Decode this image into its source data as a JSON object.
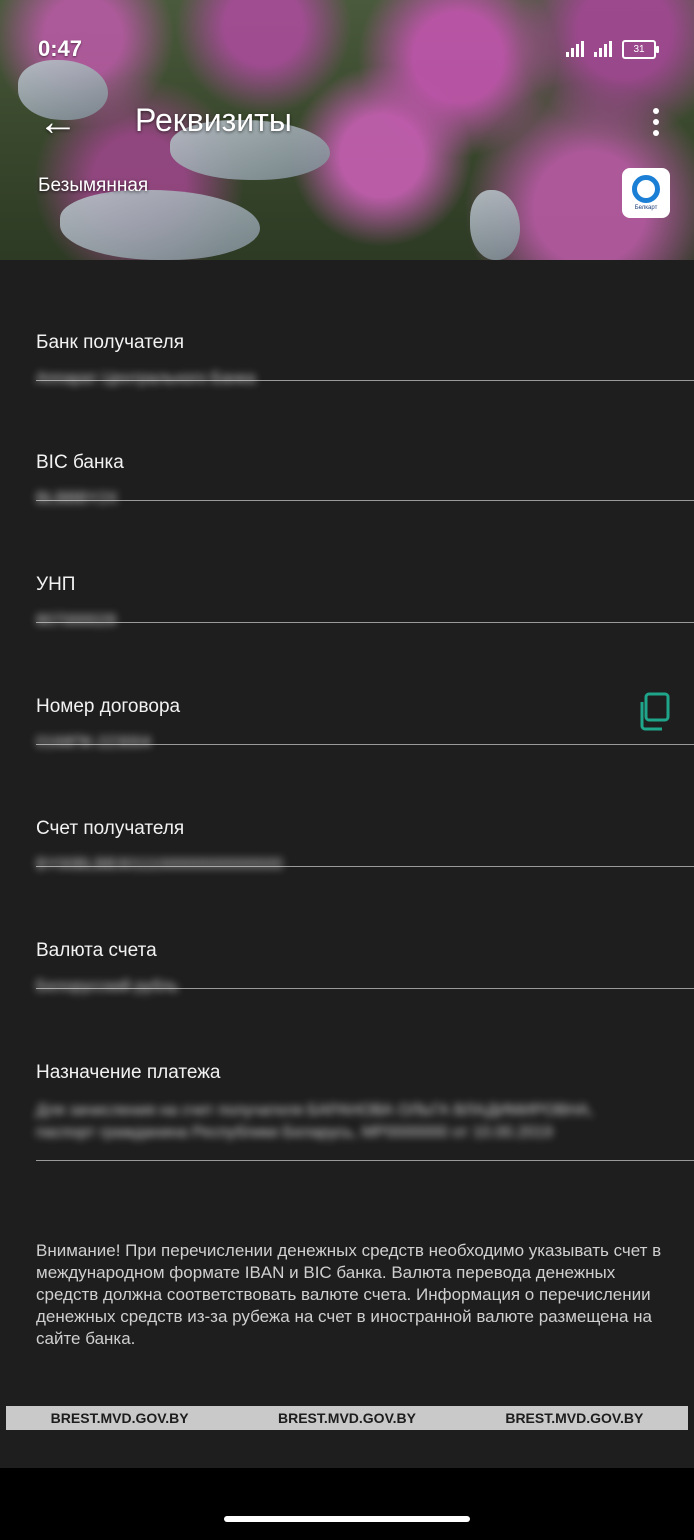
{
  "status_bar": {
    "time": "0:47",
    "battery": "31"
  },
  "header": {
    "title": "Реквизиты",
    "card_name": "Безымянная",
    "bank_logo_text": "Белкарт"
  },
  "fields": [
    {
      "label": "Банк получателя",
      "value": "Аппарат Центрального Банка"
    },
    {
      "label": "BIC банка",
      "value": "BLBBBY2X"
    },
    {
      "label": "УНП",
      "value": "807000028"
    },
    {
      "label": "Номер договора",
      "value": "0168ПК-223004"
    },
    {
      "label": "Счет получателя",
      "value": "BY00BLBB3011100000000000000"
    },
    {
      "label": "Валюта счета",
      "value": "Белорусский рубль"
    },
    {
      "label": "Назначение платежа",
      "value": "Для зачисления на счет получателя БАРАНОВА ОЛЬГА ВЛАДИМИРОВНА, паспорт гражданина Республики Беларусь, MP0000000 от 10.00.2019"
    }
  ],
  "notice": "Внимание! При перечислении денежных средств необходимо указывать счет в международном формате IBAN и BIC банка. Валюта перевода денежных средств должна соответствовать валюте счета. Информация о перечислении денежных средств из-за рубежа на счет в иностранной валюте размещена на сайте банка.",
  "watermark": [
    "BREST.MVD.GOV.BY",
    "BREST.MVD.GOV.BY",
    "BREST.MVD.GOV.BY"
  ],
  "icons": {
    "back": "arrow-left-icon",
    "menu": "more-vert-icon",
    "copy": "copy-icon"
  },
  "colors": {
    "background": "#1e1e1e",
    "accent": "#1fa58a",
    "divider": "#9a9a9a"
  }
}
